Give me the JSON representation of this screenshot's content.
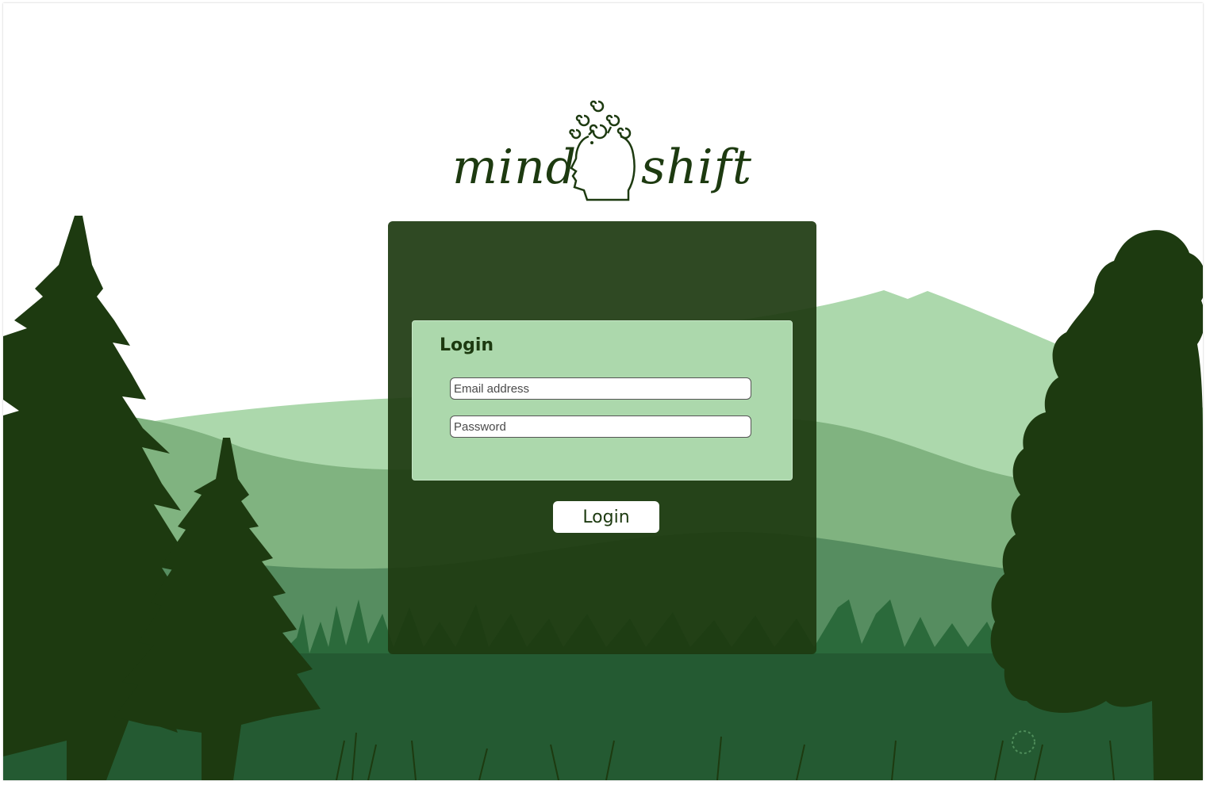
{
  "brand": {
    "name_left": "mind",
    "name_right": "shift",
    "logo_icon": "head-with-spirals-icon"
  },
  "login_form": {
    "title": "Login",
    "email_placeholder": "Email address",
    "email_value": "",
    "password_placeholder": "Password",
    "password_value": "",
    "submit_label": "Login"
  },
  "colors": {
    "dark_forest": "#1d3a10",
    "light_green": "#acd8ac",
    "mid_green": "#80b380",
    "deep_green": "#245a32"
  }
}
